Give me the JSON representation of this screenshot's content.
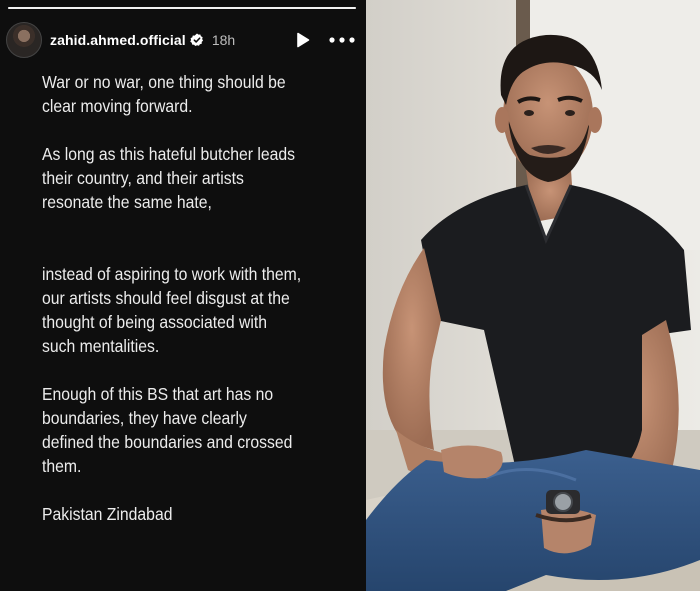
{
  "story": {
    "username": "zahid.ahmed.official",
    "time": "18h",
    "progress": 1.0,
    "icons": {
      "verified": "verified-badge-icon",
      "play": "play-icon",
      "more": "more-options-icon"
    },
    "paragraphs": [
      [
        "War or no war, one thing should be",
        "clear moving forward."
      ],
      [
        "As long as this hateful butcher leads",
        "their country, and their artists",
        "resonate the same hate,"
      ],
      [
        "instead of aspiring to work with them,",
        "our artists should feel disgust at the",
        "thought of being associated with",
        "such mentalities."
      ],
      [
        "Enough of this BS that art has no",
        "boundaries, they have clearly",
        "defined the boundaries and crossed",
        "them."
      ],
      [
        "Pakistan Zindabad"
      ]
    ]
  },
  "colors": {
    "story_bg": "#0e0e0e",
    "text": "#ececec",
    "verified": "#ffffff"
  }
}
